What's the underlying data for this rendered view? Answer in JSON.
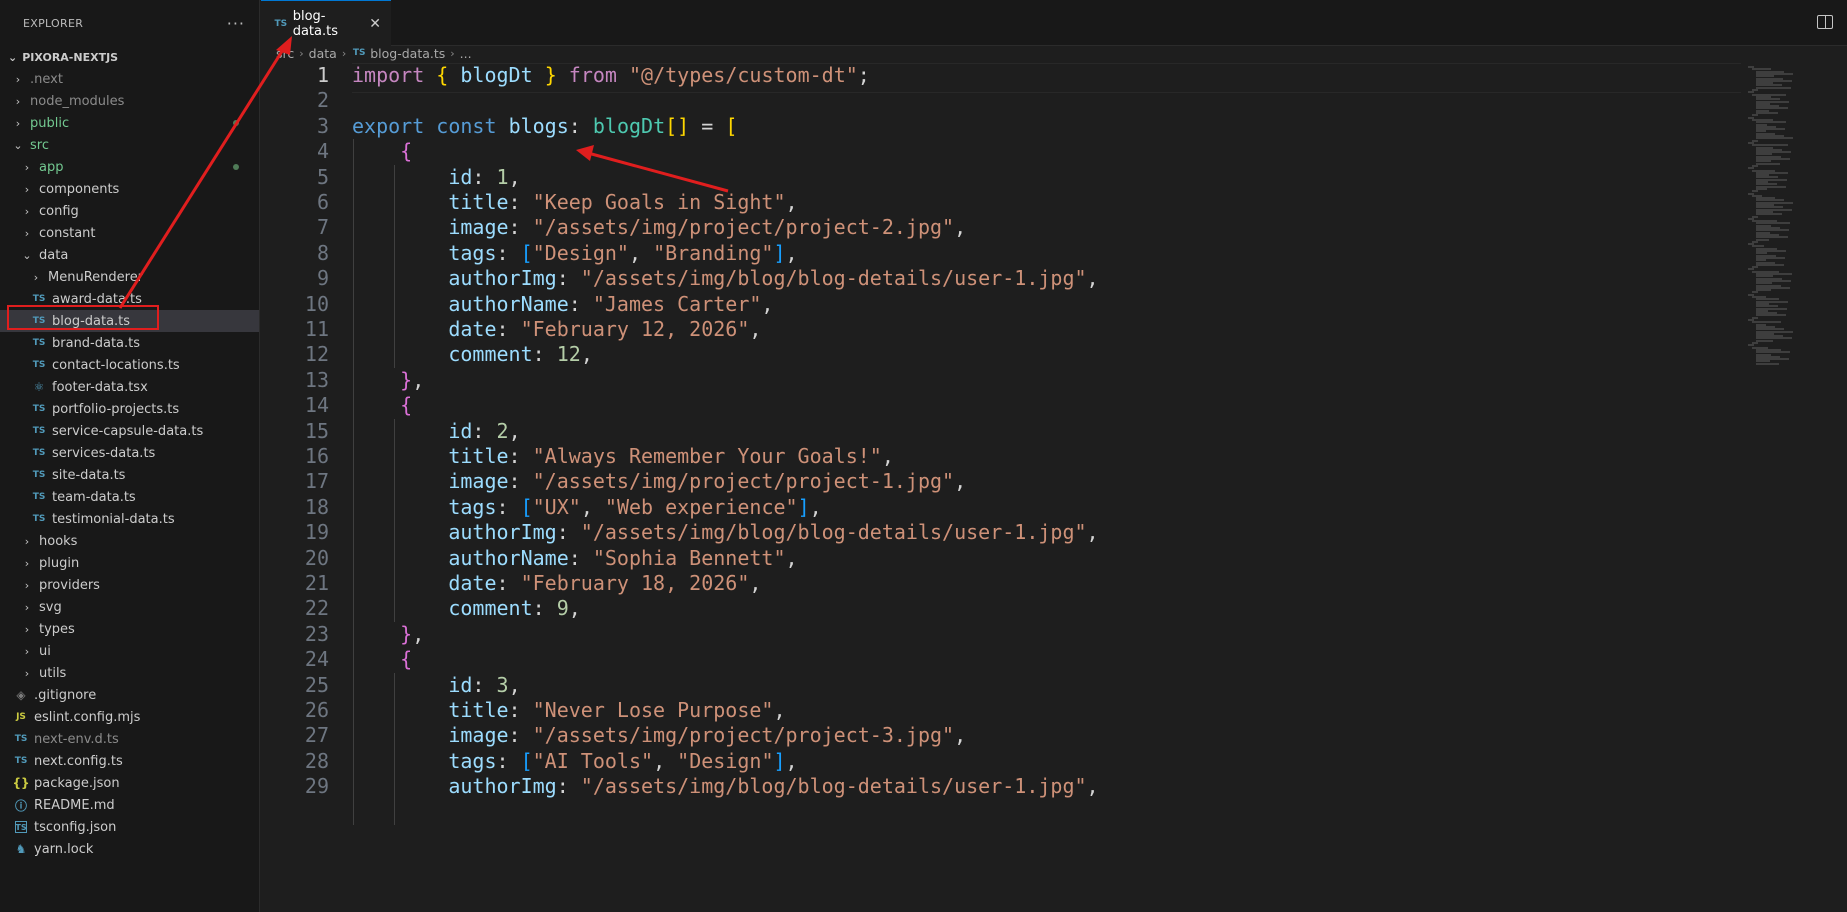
{
  "explorer": {
    "title": "EXPLORER",
    "more": "···",
    "root": "PIXORA-NEXTJS",
    "items": [
      {
        "label": ".next",
        "kind": "folder",
        "depth": 0,
        "open": false,
        "style": "dim"
      },
      {
        "label": "node_modules",
        "kind": "folder",
        "depth": 0,
        "open": false,
        "style": "dim"
      },
      {
        "label": "public",
        "kind": "folder",
        "depth": 0,
        "open": false,
        "style": "green",
        "dot": true
      },
      {
        "label": "src",
        "kind": "folder",
        "depth": 0,
        "open": true,
        "style": "green"
      },
      {
        "label": "app",
        "kind": "folder",
        "depth": 1,
        "open": false,
        "style": "green",
        "dot": true
      },
      {
        "label": "components",
        "kind": "folder",
        "depth": 1,
        "open": false
      },
      {
        "label": "config",
        "kind": "folder",
        "depth": 1,
        "open": false
      },
      {
        "label": "constant",
        "kind": "folder",
        "depth": 1,
        "open": false
      },
      {
        "label": "data",
        "kind": "folder",
        "depth": 1,
        "open": true
      },
      {
        "label": "MenuRenderer",
        "kind": "folder",
        "depth": 2,
        "open": false
      },
      {
        "label": "award-data.ts",
        "kind": "file",
        "icon": "TS",
        "depth": 2
      },
      {
        "label": "blog-data.ts",
        "kind": "file",
        "icon": "TS",
        "depth": 2,
        "selected": true
      },
      {
        "label": "brand-data.ts",
        "kind": "file",
        "icon": "TS",
        "depth": 2
      },
      {
        "label": "contact-locations.ts",
        "kind": "file",
        "icon": "TS",
        "depth": 2
      },
      {
        "label": "footer-data.tsx",
        "kind": "file",
        "icon": "react",
        "depth": 2
      },
      {
        "label": "portfolio-projects.ts",
        "kind": "file",
        "icon": "TS",
        "depth": 2
      },
      {
        "label": "service-capsule-data.ts",
        "kind": "file",
        "icon": "TS",
        "depth": 2
      },
      {
        "label": "services-data.ts",
        "kind": "file",
        "icon": "TS",
        "depth": 2
      },
      {
        "label": "site-data.ts",
        "kind": "file",
        "icon": "TS",
        "depth": 2
      },
      {
        "label": "team-data.ts",
        "kind": "file",
        "icon": "TS",
        "depth": 2
      },
      {
        "label": "testimonial-data.ts",
        "kind": "file",
        "icon": "TS",
        "depth": 2
      },
      {
        "label": "hooks",
        "kind": "folder",
        "depth": 1,
        "open": false
      },
      {
        "label": "plugin",
        "kind": "folder",
        "depth": 1,
        "open": false
      },
      {
        "label": "providers",
        "kind": "folder",
        "depth": 1,
        "open": false
      },
      {
        "label": "svg",
        "kind": "folder",
        "depth": 1,
        "open": false
      },
      {
        "label": "types",
        "kind": "folder",
        "depth": 1,
        "open": false
      },
      {
        "label": "ui",
        "kind": "folder",
        "depth": 1,
        "open": false
      },
      {
        "label": "utils",
        "kind": "folder",
        "depth": 1,
        "open": false
      },
      {
        "label": ".gitignore",
        "kind": "file",
        "icon": "git",
        "depth": 0
      },
      {
        "label": "eslint.config.mjs",
        "kind": "file",
        "icon": "JS",
        "depth": 0
      },
      {
        "label": "next-env.d.ts",
        "kind": "file",
        "icon": "TS",
        "depth": 0,
        "style": "dim"
      },
      {
        "label": "next.config.ts",
        "kind": "file",
        "icon": "TS",
        "depth": 0
      },
      {
        "label": "package.json",
        "kind": "file",
        "icon": "json",
        "depth": 0
      },
      {
        "label": "README.md",
        "kind": "file",
        "icon": "info",
        "depth": 0
      },
      {
        "label": "tsconfig.json",
        "kind": "file",
        "icon": "tsconf",
        "depth": 0
      },
      {
        "label": "yarn.lock",
        "kind": "file",
        "icon": "yarn",
        "depth": 0
      }
    ]
  },
  "tab": {
    "icon": "TS",
    "label": "blog-data.ts",
    "close": "✕"
  },
  "breadcrumb": [
    "src",
    "data",
    "blog-data.ts",
    "..."
  ],
  "editor": {
    "active_line": 1,
    "lines": [
      [
        [
          "kw",
          "import"
        ],
        [
          "pun",
          " "
        ],
        [
          "b1",
          "{"
        ],
        [
          "pun",
          " "
        ],
        [
          "var",
          "blogDt"
        ],
        [
          "pun",
          " "
        ],
        [
          "b1",
          "}"
        ],
        [
          "pun",
          " "
        ],
        [
          "kw",
          "from"
        ],
        [
          "pun",
          " "
        ],
        [
          "str",
          "\"@/types/custom-dt\""
        ],
        [
          "pun",
          ";"
        ]
      ],
      [],
      [
        [
          "kw2",
          "export"
        ],
        [
          "pun",
          " "
        ],
        [
          "kw2",
          "const"
        ],
        [
          "pun",
          " "
        ],
        [
          "var",
          "blogs"
        ],
        [
          "pun",
          ": "
        ],
        [
          "type",
          "blogDt"
        ],
        [
          "b1",
          "[]"
        ],
        [
          "pun",
          " = "
        ],
        [
          "b1",
          "["
        ]
      ],
      [
        [
          "pun",
          "    "
        ],
        [
          "b2",
          "{"
        ]
      ],
      [
        [
          "pun",
          "        "
        ],
        [
          "prop",
          "id"
        ],
        [
          "pun",
          ": "
        ],
        [
          "num",
          "1"
        ],
        [
          "pun",
          ","
        ]
      ],
      [
        [
          "pun",
          "        "
        ],
        [
          "prop",
          "title"
        ],
        [
          "pun",
          ": "
        ],
        [
          "str",
          "\"Keep Goals in Sight\""
        ],
        [
          "pun",
          ","
        ]
      ],
      [
        [
          "pun",
          "        "
        ],
        [
          "prop",
          "image"
        ],
        [
          "pun",
          ": "
        ],
        [
          "str",
          "\"/assets/img/project/project-2.jpg\""
        ],
        [
          "pun",
          ","
        ]
      ],
      [
        [
          "pun",
          "        "
        ],
        [
          "prop",
          "tags"
        ],
        [
          "pun",
          ": "
        ],
        [
          "b3",
          "["
        ],
        [
          "str",
          "\"Design\""
        ],
        [
          "pun",
          ", "
        ],
        [
          "str",
          "\"Branding\""
        ],
        [
          "b3",
          "]"
        ],
        [
          "pun",
          ","
        ]
      ],
      [
        [
          "pun",
          "        "
        ],
        [
          "prop",
          "authorImg"
        ],
        [
          "pun",
          ": "
        ],
        [
          "str",
          "\"/assets/img/blog/blog-details/user-1.jpg\""
        ],
        [
          "pun",
          ","
        ]
      ],
      [
        [
          "pun",
          "        "
        ],
        [
          "prop",
          "authorName"
        ],
        [
          "pun",
          ": "
        ],
        [
          "str",
          "\"James Carter\""
        ],
        [
          "pun",
          ","
        ]
      ],
      [
        [
          "pun",
          "        "
        ],
        [
          "prop",
          "date"
        ],
        [
          "pun",
          ": "
        ],
        [
          "str",
          "\"February 12, 2026\""
        ],
        [
          "pun",
          ","
        ]
      ],
      [
        [
          "pun",
          "        "
        ],
        [
          "prop",
          "comment"
        ],
        [
          "pun",
          ": "
        ],
        [
          "num",
          "12"
        ],
        [
          "pun",
          ","
        ]
      ],
      [
        [
          "pun",
          "    "
        ],
        [
          "b2",
          "}"
        ],
        [
          "pun",
          ","
        ]
      ],
      [
        [
          "pun",
          "    "
        ],
        [
          "b2",
          "{"
        ]
      ],
      [
        [
          "pun",
          "        "
        ],
        [
          "prop",
          "id"
        ],
        [
          "pun",
          ": "
        ],
        [
          "num",
          "2"
        ],
        [
          "pun",
          ","
        ]
      ],
      [
        [
          "pun",
          "        "
        ],
        [
          "prop",
          "title"
        ],
        [
          "pun",
          ": "
        ],
        [
          "str",
          "\"Always Remember Your Goals!\""
        ],
        [
          "pun",
          ","
        ]
      ],
      [
        [
          "pun",
          "        "
        ],
        [
          "prop",
          "image"
        ],
        [
          "pun",
          ": "
        ],
        [
          "str",
          "\"/assets/img/project/project-1.jpg\""
        ],
        [
          "pun",
          ","
        ]
      ],
      [
        [
          "pun",
          "        "
        ],
        [
          "prop",
          "tags"
        ],
        [
          "pun",
          ": "
        ],
        [
          "b3",
          "["
        ],
        [
          "str",
          "\"UX\""
        ],
        [
          "pun",
          ", "
        ],
        [
          "str",
          "\"Web experience\""
        ],
        [
          "b3",
          "]"
        ],
        [
          "pun",
          ","
        ]
      ],
      [
        [
          "pun",
          "        "
        ],
        [
          "prop",
          "authorImg"
        ],
        [
          "pun",
          ": "
        ],
        [
          "str",
          "\"/assets/img/blog/blog-details/user-1.jpg\""
        ],
        [
          "pun",
          ","
        ]
      ],
      [
        [
          "pun",
          "        "
        ],
        [
          "prop",
          "authorName"
        ],
        [
          "pun",
          ": "
        ],
        [
          "str",
          "\"Sophia Bennett\""
        ],
        [
          "pun",
          ","
        ]
      ],
      [
        [
          "pun",
          "        "
        ],
        [
          "prop",
          "date"
        ],
        [
          "pun",
          ": "
        ],
        [
          "str",
          "\"February 18, 2026\""
        ],
        [
          "pun",
          ","
        ]
      ],
      [
        [
          "pun",
          "        "
        ],
        [
          "prop",
          "comment"
        ],
        [
          "pun",
          ": "
        ],
        [
          "num",
          "9"
        ],
        [
          "pun",
          ","
        ]
      ],
      [
        [
          "pun",
          "    "
        ],
        [
          "b2",
          "}"
        ],
        [
          "pun",
          ","
        ]
      ],
      [
        [
          "pun",
          "    "
        ],
        [
          "b2",
          "{"
        ]
      ],
      [
        [
          "pun",
          "        "
        ],
        [
          "prop",
          "id"
        ],
        [
          "pun",
          ": "
        ],
        [
          "num",
          "3"
        ],
        [
          "pun",
          ","
        ]
      ],
      [
        [
          "pun",
          "        "
        ],
        [
          "prop",
          "title"
        ],
        [
          "pun",
          ": "
        ],
        [
          "str",
          "\"Never Lose Purpose\""
        ],
        [
          "pun",
          ","
        ]
      ],
      [
        [
          "pun",
          "        "
        ],
        [
          "prop",
          "image"
        ],
        [
          "pun",
          ": "
        ],
        [
          "str",
          "\"/assets/img/project/project-3.jpg\""
        ],
        [
          "pun",
          ","
        ]
      ],
      [
        [
          "pun",
          "        "
        ],
        [
          "prop",
          "tags"
        ],
        [
          "pun",
          ": "
        ],
        [
          "b3",
          "["
        ],
        [
          "str",
          "\"AI Tools\""
        ],
        [
          "pun",
          ", "
        ],
        [
          "str",
          "\"Design\""
        ],
        [
          "b3",
          "]"
        ],
        [
          "pun",
          ","
        ]
      ],
      [
        [
          "pun",
          "        "
        ],
        [
          "prop",
          "authorImg"
        ],
        [
          "pun",
          ": "
        ],
        [
          "str",
          "\"/assets/img/blog/blog-details/user-1.jpg\""
        ],
        [
          "pun",
          ","
        ]
      ]
    ]
  },
  "colors": {
    "annotation": "#e01e1e",
    "accent": "#0078d4",
    "editor_bg": "#1e1e1e",
    "sidebar_bg": "#181818"
  }
}
